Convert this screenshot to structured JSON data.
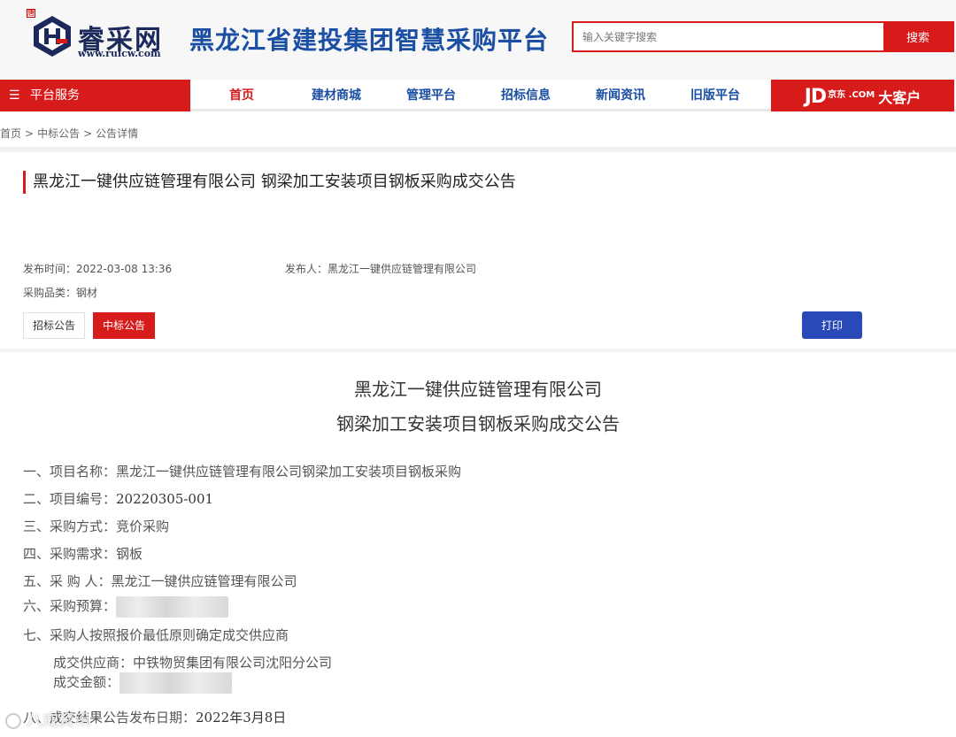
{
  "header": {
    "logo_stamp": "唐",
    "logo_text": "睿采网",
    "logo_url": "www.ruicw.com",
    "platform_title": "黑龙江省建投集团智慧采购平台",
    "search_placeholder": "输入关键字搜索",
    "search_button": "搜索"
  },
  "nav": {
    "service_label": "平台服务",
    "items": [
      {
        "label": "首页",
        "active": true
      },
      {
        "label": "建材商城"
      },
      {
        "label": "管理平台"
      },
      {
        "label": "招标信息"
      },
      {
        "label": "新闻资讯"
      },
      {
        "label": "旧版平台"
      }
    ],
    "jd_banner": {
      "jd": "JD",
      "small": "京东 .COM",
      "text": "大客户"
    }
  },
  "breadcrumb": [
    "首页",
    ">",
    "中标公告",
    ">",
    "公告详情"
  ],
  "announcement": {
    "title": "黑龙江一键供应链管理有限公司 钢梁加工安装项目钢板采购成交公告",
    "publish_time_label": "发布时间：",
    "publish_time": "2022-03-08 13:36",
    "publisher_label": "发布人：",
    "publisher": "黑龙江一键供应链管理有限公司",
    "category_label": "采购品类：",
    "category": "钢材",
    "tab_bid": "招标公告",
    "tab_award": "中标公告",
    "print_button": "打印"
  },
  "content": {
    "heading_line1": "黑龙江一键供应链管理有限公司",
    "heading_line2": "钢梁加工安装项目钢板采购成交公告",
    "items": [
      {
        "prefix": "一、项目名称：",
        "value": "黑龙江一键供应链管理有限公司钢梁加工安装项目钢板采购"
      },
      {
        "prefix": "二、项目编号：",
        "value": "20220305-001"
      },
      {
        "prefix": "三、采购方式：",
        "value": "竞价采购"
      },
      {
        "prefix": "四、采购需求：",
        "value": "钢板"
      },
      {
        "prefix": "五、采 购 人：",
        "value": "黑龙江一键供应链管理有限公司"
      },
      {
        "prefix": "六、采购预算：",
        "value": ""
      },
      {
        "prefix": "七、采购人按照报价最低原则确定成交供应商",
        "value": ""
      }
    ],
    "supplier_label": "成交供应商：",
    "supplier": "中铁物贸集团有限公司沈阳分公司",
    "amount_label": "成交金额：",
    "result_date_prefix": "八、成交结果公告发布日期：",
    "result_date": "2022年3月8日"
  },
  "watermark": "八戒资讯"
}
